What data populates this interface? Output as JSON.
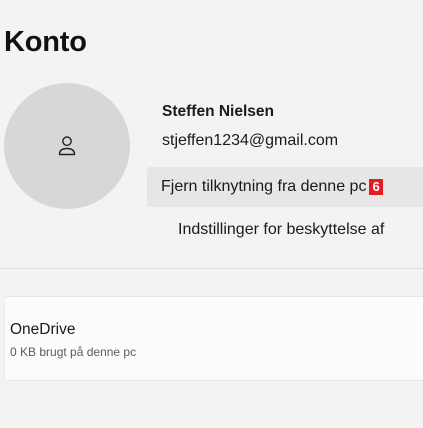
{
  "page": {
    "title": "Konto"
  },
  "account": {
    "avatar_icon": "person-icon",
    "name": "Steffen Nielsen",
    "email": "stjeffen1234@gmail.com",
    "disconnect_label": "Fjern tilknytning fra denne pc",
    "badge_number": "6",
    "protection_link": "Indstillinger for beskyttelse af"
  },
  "onedrive": {
    "title": "OneDrive",
    "usage": "0 KB brugt på denne pc"
  },
  "colors": {
    "background": "#f3f3f3",
    "avatar_fill": "#d7d7d7",
    "button_fill": "#e6e6e6",
    "badge": "#e21d24",
    "card_fill": "#fbfbfb"
  }
}
